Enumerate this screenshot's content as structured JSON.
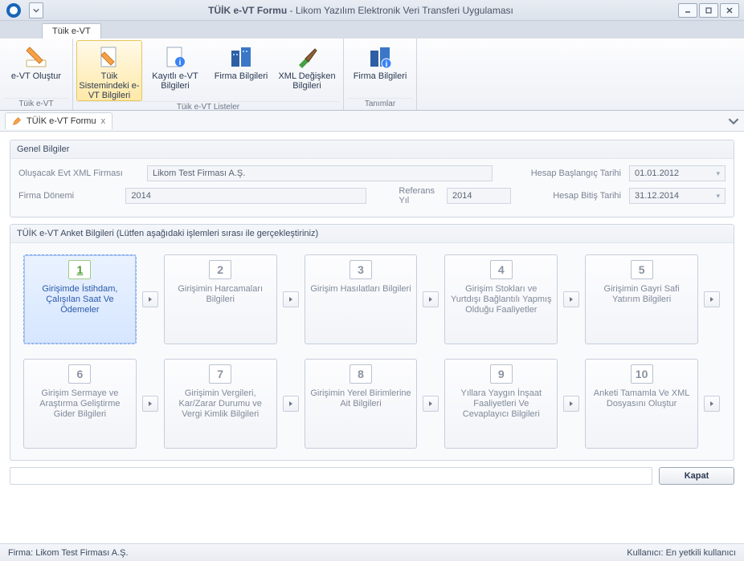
{
  "title": {
    "prefix": "TÜİK e-VT Formu",
    "separator": " - ",
    "suffix": "Likom Yazılım Elektronik Veri Transferi Uygulaması"
  },
  "ribbon": {
    "tab": "Tüik e-VT",
    "groups": [
      {
        "title": "Tüik e-VT",
        "items": [
          {
            "label": "e-VT Oluştur",
            "icon": "pencil-icon"
          }
        ]
      },
      {
        "title": "Tüik e-VT Listeler",
        "items": [
          {
            "label": "Tüik Sistemindeki e-VT Bilgileri",
            "icon": "doc-pencil-icon",
            "hover": true
          },
          {
            "label": "Kayıtlı e-VT Bilgileri",
            "icon": "doc-info-icon"
          },
          {
            "label": "Firma Bilgileri",
            "icon": "buildings-icon"
          },
          {
            "label": "XML Değişken Bilgileri",
            "icon": "brush-icon"
          }
        ]
      },
      {
        "title": "Tanımlar",
        "items": [
          {
            "label": "Firma Bilgileri",
            "icon": "buildings-info-icon"
          }
        ]
      }
    ]
  },
  "docTab": {
    "label": "TÜİK e-VT Formu",
    "close": "x"
  },
  "general": {
    "title": "Genel Bilgiler",
    "fields": {
      "xmlFirmLabel": "Oluşacak Evt XML Firması",
      "xmlFirmValue": "Likom Test Firması A.Ş.",
      "periodLabel": "Firma Dönemi",
      "periodValue": "2014",
      "refYearLabel": "Referans Yıl",
      "refYearValue": "2014",
      "startDateLabel": "Hesap Başlangıç Tarihi",
      "startDateValue": "01.01.2012",
      "endDateLabel": "Hesap Bitiş Tarihi",
      "endDateValue": "31.12.2014"
    }
  },
  "steps": {
    "title": "TÜİK e-VT Anket Bilgileri (Lütfen aşağıdaki işlemleri sırası ile gerçekleştiriniz)",
    "items": [
      {
        "num": "1",
        "label": "Girişimde İstihdam, Çalışılan Saat Ve Ödemeler",
        "active": true
      },
      {
        "num": "2",
        "label": "Girişimin Harcamaları Bilgileri"
      },
      {
        "num": "3",
        "label": "Girişim Hasılatları Bilgileri"
      },
      {
        "num": "4",
        "label": "Girişim Stokları ve Yurtdışı Bağlantılı Yapmış Olduğu Faaliyetler"
      },
      {
        "num": "5",
        "label": "Girişimin Gayri Safi Yatırım Bilgileri"
      },
      {
        "num": "6",
        "label": "Girişim Sermaye ve Araştırma Geliştirme Gider Bilgileri"
      },
      {
        "num": "7",
        "label": "Girişimin Vergileri, Kar/Zarar Durumu ve Vergi Kimlik Bilgileri"
      },
      {
        "num": "8",
        "label": "Girişimin Yerel Birimlerine Ait Bilgileri"
      },
      {
        "num": "9",
        "label": "Yıllara Yaygın İnşaat Faaliyetleri Ve Cevaplayıcı Bilgileri"
      },
      {
        "num": "10",
        "label": "Anketi Tamamla Ve XML Dosyasını Oluştur"
      }
    ]
  },
  "buttons": {
    "close": "Kapat"
  },
  "status": {
    "left_label": "Firma:",
    "left_value": "Likom Test Firması A.Ş.",
    "right_label": "Kullanıcı:",
    "right_value": "En yetkili kullanıcı"
  }
}
